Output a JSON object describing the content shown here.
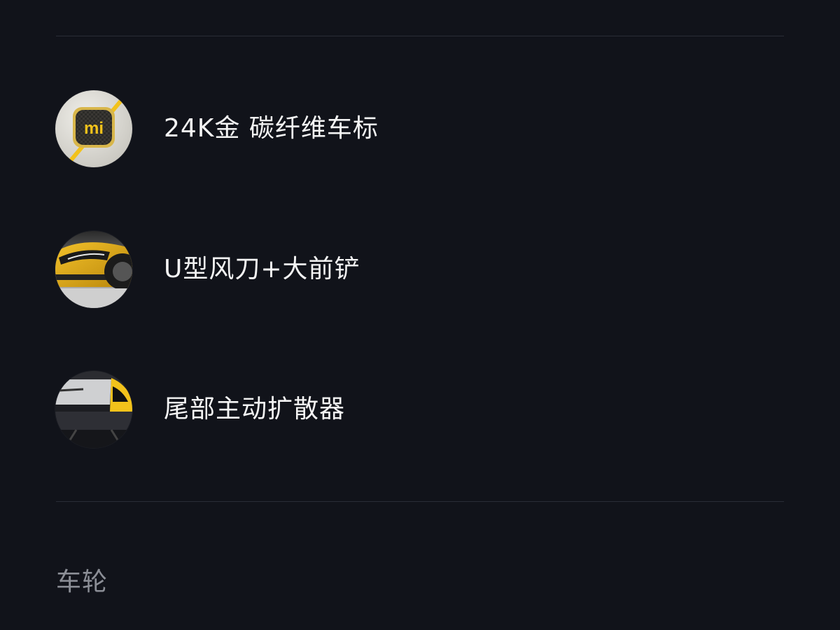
{
  "features": [
    {
      "label": "24K金 碳纤维车标",
      "icon": "mi-logo-badge"
    },
    {
      "label": "U型风刀+大前铲",
      "icon": "front-bumper-photo"
    },
    {
      "label": "尾部主动扩散器",
      "icon": "rear-diffuser-photo"
    }
  ],
  "badge_text": "mi",
  "section": {
    "title": "车轮"
  },
  "colors": {
    "background": "#11131a",
    "divider": "#2a2d36",
    "label": "#f4f4f4",
    "section_title": "#8b8e96",
    "accent_gold": "#f2c21b"
  }
}
